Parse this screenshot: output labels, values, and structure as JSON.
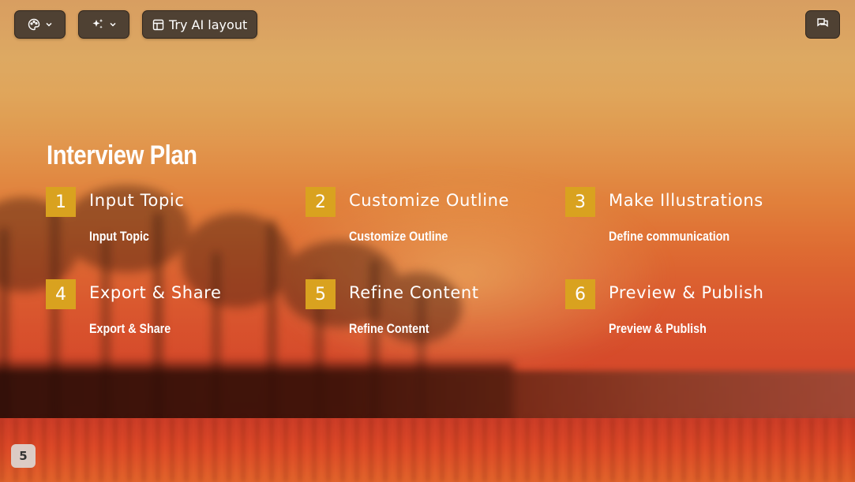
{
  "toolbar": {
    "theme_icon": "palette-icon",
    "ai_icon": "sparkle-icon",
    "try_ai_layout_label": "Try AI layout",
    "comment_icon": "comment-icon"
  },
  "slide": {
    "title": "Interview Plan",
    "steps": [
      {
        "number": "1",
        "heading": "Input Topic",
        "description": "Input Topic"
      },
      {
        "number": "2",
        "heading": "Customize Outline",
        "description": "Customize Outline"
      },
      {
        "number": "3",
        "heading": "Make Illustrations",
        "description": "Define communication"
      },
      {
        "number": "4",
        "heading": "Export & Share",
        "description": "Export & Share"
      },
      {
        "number": "5",
        "heading": "Refine Content",
        "description": "Refine Content"
      },
      {
        "number": "6",
        "heading": "Preview & Publish",
        "description": "Preview & Publish"
      }
    ]
  },
  "page_number": "5",
  "colors": {
    "number_badge": "#d9a21f",
    "toolbar_bg": "#463a30"
  }
}
